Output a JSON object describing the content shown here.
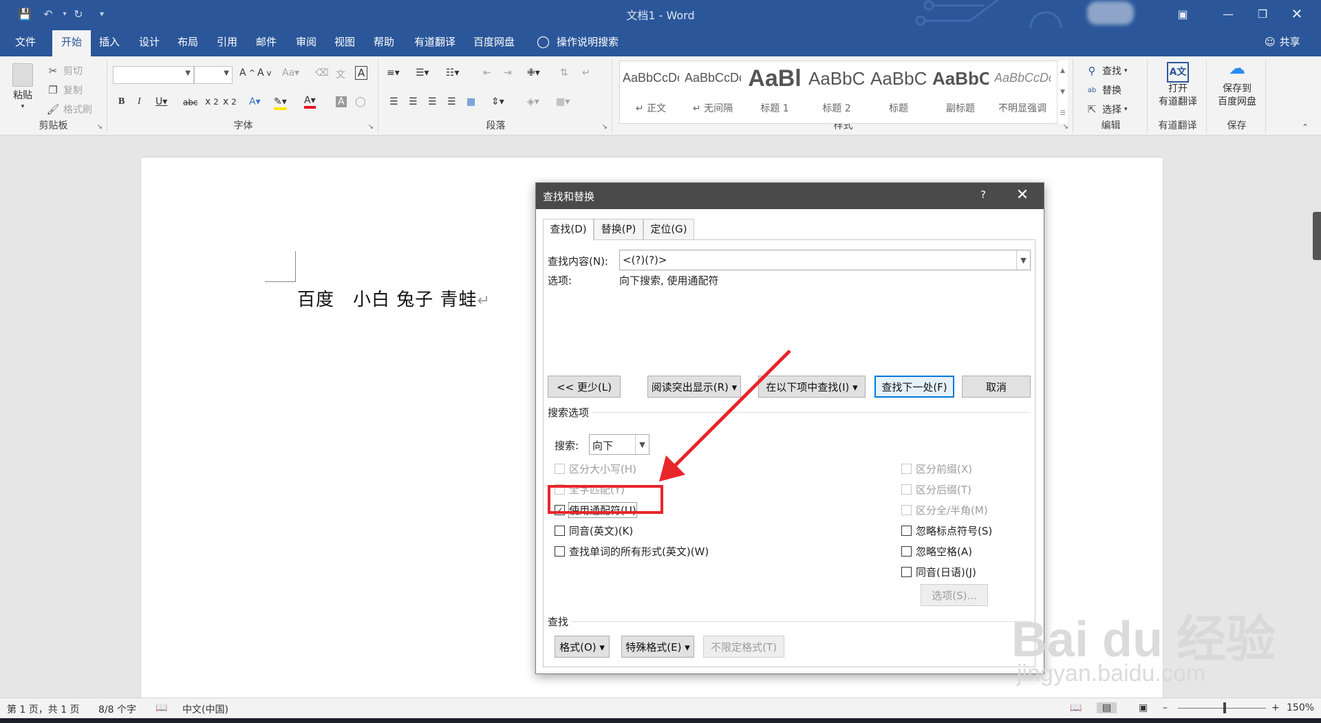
{
  "window": {
    "title": "文档1 - Word",
    "quick_access": [
      "save-icon",
      "undo-icon",
      "redo-icon",
      "customize-icon"
    ]
  },
  "tabs": [
    {
      "label": "文件"
    },
    {
      "label": "开始"
    },
    {
      "label": "插入"
    },
    {
      "label": "设计"
    },
    {
      "label": "布局"
    },
    {
      "label": "引用"
    },
    {
      "label": "邮件"
    },
    {
      "label": "审阅"
    },
    {
      "label": "视图"
    },
    {
      "label": "帮助"
    },
    {
      "label": "有道翻译"
    },
    {
      "label": "百度网盘"
    }
  ],
  "tell_me": "操作说明搜索",
  "share": "共享",
  "ribbon": {
    "clipboard": {
      "label": "剪贴板",
      "paste": "粘贴",
      "cut": "剪切",
      "copy": "复制",
      "format_painter": "格式刷"
    },
    "font": {
      "label": "字体"
    },
    "paragraph": {
      "label": "段落"
    },
    "styles": {
      "label": "样式",
      "items": [
        {
          "sample": "AaBbCcDc",
          "name": "↵ 正文"
        },
        {
          "sample": "AaBbCcDc",
          "name": "↵ 无间隔"
        },
        {
          "sample": "AaBl",
          "name": "标题 1"
        },
        {
          "sample": "AaBbC",
          "name": "标题 2"
        },
        {
          "sample": "AaBbC",
          "name": "标题"
        },
        {
          "sample": "AaBbC",
          "name": "副标题"
        },
        {
          "sample": "AaBbCcDc",
          "name": "不明显强调"
        }
      ]
    },
    "editing": {
      "label": "编辑",
      "find": "查找",
      "replace": "替换",
      "select": "选择"
    },
    "youdao": {
      "label": "有道翻译",
      "open": "打开",
      "open2": "有道翻译"
    },
    "baidu": {
      "label": "保存",
      "save": "保存到",
      "save2": "百度网盘"
    }
  },
  "document": {
    "text": "百度　小白 兔子 青蛙",
    "para_mark": "↵"
  },
  "dialog": {
    "title": "查找和替换",
    "help": "?",
    "tabs": [
      "查找(D)",
      "替换(P)",
      "定位(G)"
    ],
    "find_label": "查找内容(N):",
    "find_value": "<(?)(?)>",
    "options_label": "选项:",
    "options_value": "向下搜索, 使用通配符",
    "buttons": {
      "less": "<< 更少(L)",
      "reading_highlight": "阅读突出显示(R) ▾",
      "find_in": "在以下项中查找(I) ▾",
      "find_next": "查找下一处(F)",
      "cancel": "取消"
    },
    "search_options_label": "搜索选项",
    "search_label": "搜索:",
    "search_value": "向下",
    "checks_left": [
      {
        "label": "区分大小写(H)",
        "checked": false,
        "enabled": false
      },
      {
        "label": "全字匹配(Y)",
        "checked": false,
        "enabled": false
      },
      {
        "label": "使用通配符(U)",
        "checked": true,
        "enabled": true
      },
      {
        "label": "同音(英文)(K)",
        "checked": false,
        "enabled": true
      },
      {
        "label": "查找单词的所有形式(英文)(W)",
        "checked": false,
        "enabled": true
      }
    ],
    "checks_right": [
      {
        "label": "区分前缀(X)",
        "checked": false,
        "enabled": false
      },
      {
        "label": "区分后缀(T)",
        "checked": false,
        "enabled": false
      },
      {
        "label": "区分全/半角(M)",
        "checked": false,
        "enabled": false
      },
      {
        "label": "忽略标点符号(S)",
        "checked": false,
        "enabled": true
      },
      {
        "label": "忽略空格(A)",
        "checked": false,
        "enabled": true
      },
      {
        "label": "同音(日语)(J)",
        "checked": false,
        "enabled": true
      }
    ],
    "options_button": "选项(S)...",
    "find_section_label": "查找",
    "format_button": "格式(O) ▾",
    "special_button": "特殊格式(E) ▾",
    "no_format_button": "不限定格式(T)"
  },
  "status": {
    "page": "第 1 页，共 1 页",
    "words": "8/8 个字",
    "language": "中文(中国)",
    "zoom": "150%",
    "zoom_fraction": 0.53
  },
  "watermark": {
    "brand": "Bai du 经验",
    "url": "jingyan.baidu.com"
  },
  "colors": {
    "brand": "#2b579a",
    "highlight": "#e8252a",
    "dialog_title": "#4a4a4a"
  }
}
